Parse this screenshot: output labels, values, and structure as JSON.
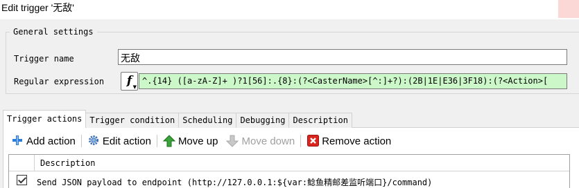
{
  "window": {
    "title": "Edit trigger '无敌'"
  },
  "general": {
    "legend": "General settings",
    "trigger_name_label": "Trigger name",
    "trigger_name_value": "无敌",
    "regex_label": "Regular expression",
    "regex_button_label": "f",
    "regex_value": "^.{14} ([a-zA-Z]+ )?1[56]:.{8}:(?<CasterName>[^:]+?):(2B|1E|E36|3F18):(?<Action>["
  },
  "tabs": [
    {
      "label": "Trigger actions",
      "active": true
    },
    {
      "label": "Trigger condition",
      "active": false
    },
    {
      "label": "Scheduling",
      "active": false
    },
    {
      "label": "Debugging",
      "active": false
    },
    {
      "label": "Description",
      "active": false
    }
  ],
  "toolbar": {
    "add": "Add action",
    "edit": "Edit action",
    "move_up": "Move up",
    "move_down": "Move down",
    "remove": "Remove action"
  },
  "actions_table": {
    "header_description": "Description",
    "rows": [
      {
        "checked": true,
        "description": "Send JSON payload to endpoint (http://127.0.0.1:${var:鲶鱼精邮差监听端口}/command)"
      }
    ]
  },
  "colors": {
    "regex_valid_bg": "#ccf7c8",
    "close_hover": "#fbd8d6",
    "remove_icon": "#d9251d",
    "add_icon": "#2c7bd6",
    "move_up_icon": "#3aa33a"
  }
}
